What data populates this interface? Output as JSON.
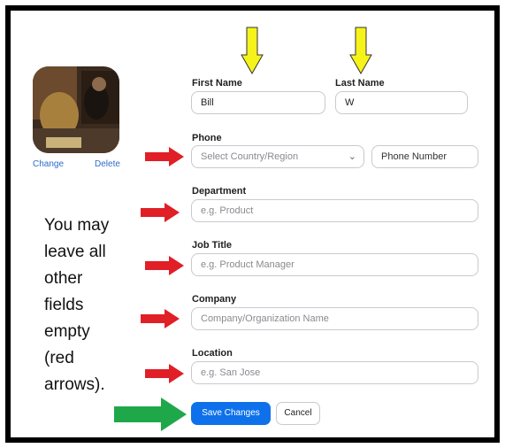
{
  "profile": {
    "change_label": "Change",
    "delete_label": "Delete"
  },
  "form": {
    "first_name_label": "First Name",
    "first_name_value": "Bill",
    "last_name_label": "Last Name",
    "last_name_value": "W",
    "phone_label": "Phone",
    "country_placeholder": "Select Country/Region",
    "phone_placeholder": "Phone Number",
    "department_label": "Department",
    "department_placeholder": "e.g. Product",
    "job_title_label": "Job Title",
    "job_title_placeholder": "e.g. Product Manager",
    "company_label": "Company",
    "company_placeholder": "Company/Organization Name",
    "location_label": "Location",
    "location_placeholder": "e.g. San Jose"
  },
  "buttons": {
    "save_label": "Save Changes",
    "cancel_label": "Cancel"
  },
  "annotation": {
    "lines": [
      "You may",
      "leave all",
      "other",
      "fields",
      "empty",
      "(red",
      "arrows)."
    ]
  },
  "colors": {
    "primary": "#0e71eb",
    "red_arrow": "#e01f26",
    "green_arrow": "#1fa84a",
    "yellow_arrow": "#f6f31b"
  }
}
